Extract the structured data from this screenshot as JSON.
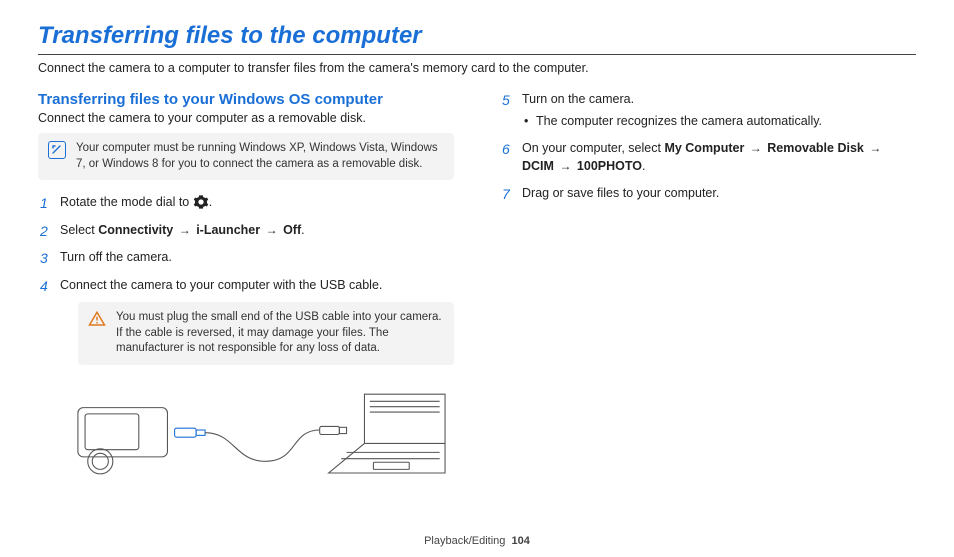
{
  "title": "Transferring files to the computer",
  "subtitle": "Connect the camera to a computer to transfer files from the camera's memory card to the computer.",
  "section": {
    "heading": "Transferring files to your Windows OS computer",
    "sub": "Connect the camera to your computer as a removable disk.",
    "note": "Your computer must be running Windows XP, Windows Vista, Windows 7, or Windows 8 for you to connect the camera as a removable disk."
  },
  "steps_left": {
    "s1_pre": "Rotate the mode dial to ",
    "s1_post": ".",
    "s2_pre": "Select ",
    "s2_b1": "Connectivity",
    "s2_b2": "i-Launcher",
    "s2_b3": "Off",
    "s2_post": ".",
    "s3": "Turn off the camera.",
    "s4": "Connect the camera to your computer with the USB cable."
  },
  "warn": "You must plug the small end of the USB cable into your camera. If the cable is reversed, it may damage your files. The manufacturer is not responsible for any loss of data.",
  "steps_right": {
    "s5": "Turn on the camera.",
    "s5_sub": "The computer recognizes the camera automatically.",
    "s6_pre": "On your computer, select ",
    "s6_b1": "My Computer",
    "s6_b2": "Removable Disk",
    "s6_b3": "DCIM",
    "s6_b4": "100PHOTO",
    "s6_post": ".",
    "s7": "Drag or save files to your computer."
  },
  "arrow": "→",
  "footer": {
    "section": "Playback/Editing",
    "page": "104"
  }
}
